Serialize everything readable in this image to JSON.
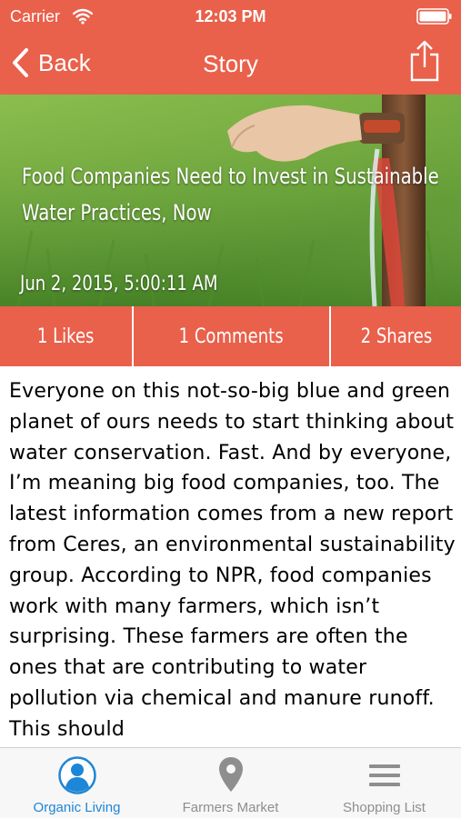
{
  "status_bar": {
    "carrier": "Carrier",
    "time": "12:03 PM",
    "wifi_icon": "wifi-icon",
    "battery_icon": "battery-icon"
  },
  "nav": {
    "back_label": "Back",
    "title": "Story",
    "share_icon": "share-icon"
  },
  "story": {
    "title": "Food Companies Need to Invest in Sustainable Water Practices, Now",
    "date": "Jun 2, 2015, 5:00:11 AM",
    "body": "Everyone on this not-so-big blue and green planet of ours needs to start thinking about water conservation. Fast. And by everyone, I’m meaning big food companies, too. The latest information comes from a new report from Ceres, an environmental sustainability group. According to NPR, food companies work with many farmers, which isn’t surprising. These farmers are often the ones that are contributing to water pollution via chemical and manure runoff. This should"
  },
  "stats": {
    "likes": "1 Likes",
    "comments": "1 Comments",
    "shares": "2 Shares"
  },
  "tabs": [
    {
      "label": "Organic Living",
      "icon": "person-icon",
      "active": true
    },
    {
      "label": "Farmers Market",
      "icon": "map-pin-icon",
      "active": false
    },
    {
      "label": "Shopping List",
      "icon": "list-icon",
      "active": false
    }
  ],
  "colors": {
    "accent": "#e9604b",
    "tab_active": "#1e86d6",
    "tab_inactive": "#8e8e8e"
  }
}
